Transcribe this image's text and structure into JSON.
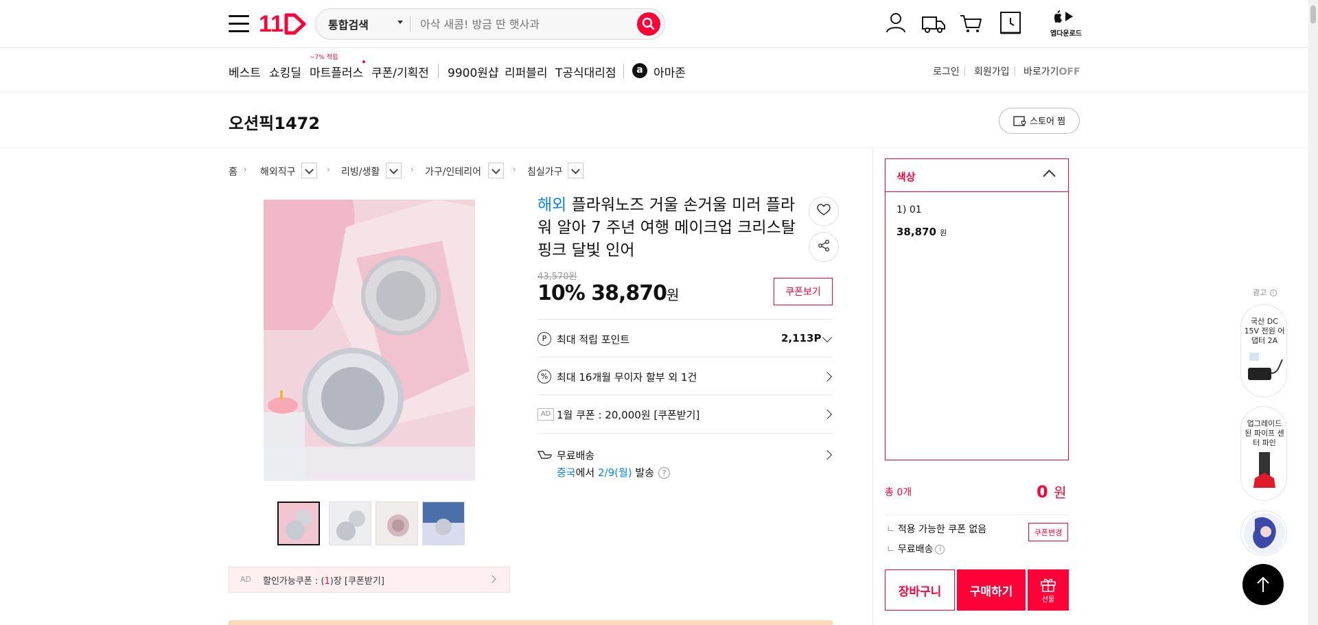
{
  "header": {
    "logo": "11st",
    "search_category": "통합검색",
    "search_placeholder": "아삭 새콤! 방금 딴 햇사과",
    "app_download": "앱다운로드"
  },
  "nav": {
    "items": [
      "베스트",
      "쇼킹딜",
      "마트플러스",
      "쿠폰/기획전",
      "9900원샵",
      "리퍼블리",
      "T공식대리점",
      "아마존"
    ],
    "mart_badge": "~7% 적립",
    "amazon_icon": "a",
    "login": "로그인",
    "signup": "회원가입",
    "shortcut": "바로가기",
    "shortcut_state": "OFF"
  },
  "store": {
    "name": "오션픽1472",
    "follow_label": "스토어 찜"
  },
  "breadcrumb": [
    "홈",
    "해외직구",
    "리빙/생활",
    "가구/인테리어",
    "침실가구"
  ],
  "product": {
    "badge": "해외",
    "title": "플라워노즈 거울 손거울 미러 플라워 알아 7 주년 여행 메이크업 크리스탈 핑크 달빛 인어",
    "original_price": "43,570원",
    "discount": "10%",
    "price": "38,870",
    "price_unit": "원",
    "coupon_view": "쿠폰보기",
    "points_label": "최대 적립 포인트",
    "points_value": "2,113P",
    "installment": "최대 16개월 무이자 할부 외 1건",
    "ad_tag": "AD",
    "coupon_row": "1월 쿠폰 : 20,000원 [쿠폰받기]",
    "shipping_label": "무료배송",
    "shipping_origin": "중국",
    "shipping_mid": "에서 ",
    "shipping_date": "2/9(월)",
    "shipping_suffix": " 발송",
    "help": "?",
    "points_icon": "P",
    "installment_icon": "%"
  },
  "coupon_bar": {
    "ad": "AD",
    "text_pre": "할인가능쿠폰 : (",
    "count": "1",
    "text_post": ")장 [쿠폰받기]"
  },
  "options": {
    "label": "색상",
    "item": "1) 01",
    "item_price": "38,870",
    "item_unit": "원",
    "total_label": "총 0개",
    "total_value": "0",
    "total_unit": "원",
    "coupon_none": "적용 가능한 쿠폰 없음",
    "coupon_change": "쿠폰변경",
    "free_ship": "무료배송",
    "info_icon": "i",
    "cart": "장바구니",
    "buy": "구매하기",
    "gift": "선물"
  },
  "ad_rail": {
    "label": "광고",
    "label_icon": "i",
    "cards": [
      "국산 DC 15V 전원 어댑터 2A",
      "업그레이드 된 파이프 센터 파인"
    ]
  },
  "colors": {
    "accent": "#ff0038",
    "link": "#0b83e6"
  }
}
